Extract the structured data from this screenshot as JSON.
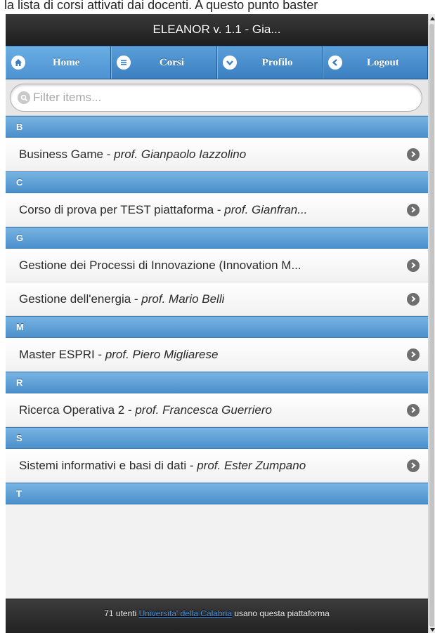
{
  "caption": "la lista di corsi attivati dai docenti. A questo punto baster",
  "header": {
    "title": "ELEANOR v. 1.1 - Gia..."
  },
  "nav": [
    {
      "label": "Home",
      "icon": "home-icon"
    },
    {
      "label": "Corsi",
      "icon": "menu-icon"
    },
    {
      "label": "Profilo",
      "icon": "chevron-down-icon"
    },
    {
      "label": "Logout",
      "icon": "chevron-left-icon"
    }
  ],
  "filter": {
    "placeholder": "Filter items..."
  },
  "sections": [
    {
      "letter": "B",
      "items": [
        {
          "course": "Business Game",
          "prof": "prof. Gianpaolo Iazzolino"
        }
      ]
    },
    {
      "letter": "C",
      "items": [
        {
          "course": "Corso di prova per TEST piattaforma",
          "prof": "prof. Gianfran..."
        }
      ]
    },
    {
      "letter": "G",
      "items": [
        {
          "course": "Gestione dei Processi di Innovazione (Innovation M...",
          "prof": ""
        },
        {
          "course": "Gestione dell'energia",
          "prof": "prof. Mario Belli"
        }
      ]
    },
    {
      "letter": "M",
      "items": [
        {
          "course": "Master ESPRI",
          "prof": "prof. Piero Migliarese"
        }
      ]
    },
    {
      "letter": "R",
      "items": [
        {
          "course": "Ricerca Operativa 2",
          "prof": "prof. Francesca Guerriero"
        }
      ]
    },
    {
      "letter": "S",
      "items": [
        {
          "course": "Sistemi informativi e basi di dati",
          "prof": "prof. Ester Zumpano"
        }
      ]
    },
    {
      "letter": "T",
      "items": []
    }
  ],
  "footer": {
    "prefix": "71 utenti",
    "link": "Universita' della Calabria",
    "suffix": "usano questa piattaforma"
  },
  "colors": {
    "accent": "#4b8fcb",
    "header": "#1e1e1e",
    "link": "#3f8ddb"
  }
}
